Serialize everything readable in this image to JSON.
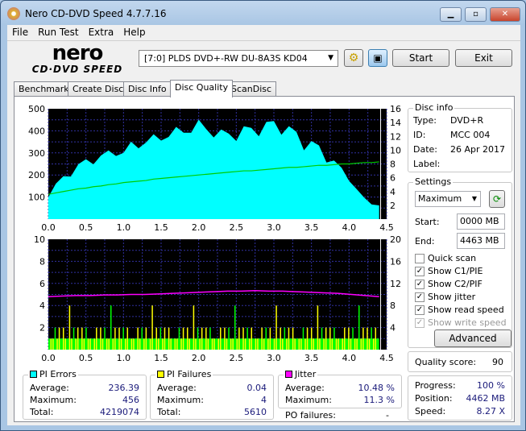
{
  "window": {
    "title": "Nero CD-DVD Speed 4.7.7.16"
  },
  "menu": [
    "File",
    "Run Test",
    "Extra",
    "Help"
  ],
  "toolbar": {
    "logo_top": "nero",
    "logo_bottom": "CD·DVD SPEED",
    "drive": "[7:0]  PLDS DVD+-RW DU-8A3S KD04",
    "start": "Start",
    "exit": "Exit"
  },
  "tabs": [
    "Benchmark",
    "Create Disc",
    "Disc Info",
    "Disc Quality",
    "ScanDisc"
  ],
  "active_tab": "Disc Quality",
  "disc_info": {
    "title": "Disc info",
    "type_label": "Type:",
    "type": "DVD+R",
    "id_label": "ID:",
    "id": "MCC 004",
    "date_label": "Date:",
    "date": "26 Apr 2017",
    "label_label": "Label:",
    "label": ""
  },
  "settings": {
    "title": "Settings",
    "speed": "Maximum",
    "start_label": "Start:",
    "start": "0000 MB",
    "end_label": "End:",
    "end": "4463 MB",
    "checks": [
      {
        "label": "Quick scan",
        "checked": false,
        "enabled": true
      },
      {
        "label": "Show C1/PIE",
        "checked": true,
        "enabled": true
      },
      {
        "label": "Show C2/PIF",
        "checked": true,
        "enabled": true
      },
      {
        "label": "Show jitter",
        "checked": true,
        "enabled": true
      },
      {
        "label": "Show read speed",
        "checked": true,
        "enabled": true
      },
      {
        "label": "Show write speed",
        "checked": true,
        "enabled": false
      }
    ],
    "advanced": "Advanced"
  },
  "quality": {
    "label": "Quality score:",
    "value": "90"
  },
  "progress": {
    "progress_label": "Progress:",
    "progress": "100 %",
    "position_label": "Position:",
    "position": "4462 MB",
    "speed_label": "Speed:",
    "speed": "8.27 X"
  },
  "pi_errors": {
    "title": "PI Errors",
    "color": "#00ffff",
    "average_label": "Average:",
    "average": "236.39",
    "maximum_label": "Maximum:",
    "maximum": "456",
    "total_label": "Total:",
    "total": "4219074"
  },
  "pi_failures": {
    "title": "PI Failures",
    "color": "#ffff00",
    "average_label": "Average:",
    "average": "0.04",
    "maximum_label": "Maximum:",
    "maximum": "4",
    "total_label": "Total:",
    "total": "5610"
  },
  "jitter": {
    "title": "Jitter",
    "color": "#ff00ff",
    "average_label": "Average:",
    "average": "10.48 %",
    "maximum_label": "Maximum:",
    "maximum": "11.3 %"
  },
  "po_failures": {
    "label": "PO failures:",
    "value": "-"
  },
  "chart_data": [
    {
      "type": "area",
      "xlim": [
        0,
        4.5
      ],
      "ylim": [
        0,
        500
      ],
      "y2lim": [
        0,
        16
      ],
      "xticks": [
        "0.0",
        "0.5",
        "1.0",
        "1.5",
        "2.0",
        "2.5",
        "3.0",
        "3.5",
        "4.0",
        "4.5"
      ],
      "yticks": [
        "100",
        "200",
        "300",
        "400",
        "500"
      ],
      "y2ticks": [
        "2",
        "4",
        "6",
        "8",
        "10",
        "12",
        "14",
        "16"
      ],
      "x": [
        0,
        0.1,
        0.2,
        0.3,
        0.4,
        0.5,
        0.6,
        0.7,
        0.8,
        0.9,
        1.0,
        1.1,
        1.2,
        1.3,
        1.4,
        1.5,
        1.6,
        1.7,
        1.8,
        1.9,
        2.0,
        2.1,
        2.2,
        2.3,
        2.4,
        2.5,
        2.6,
        2.7,
        2.8,
        2.9,
        3.0,
        3.1,
        3.2,
        3.3,
        3.4,
        3.5,
        3.6,
        3.7,
        3.8,
        3.9,
        4.0,
        4.1,
        4.2,
        4.3,
        4.4
      ],
      "series": [
        {
          "name": "PI Errors",
          "color": "#00ffff",
          "values": [
            110,
            150,
            180,
            210,
            235,
            250,
            265,
            275,
            285,
            300,
            290,
            320,
            330,
            340,
            350,
            360,
            370,
            380,
            390,
            395,
            410,
            400,
            380,
            370,
            375,
            370,
            385,
            395,
            400,
            405,
            420,
            415,
            390,
            370,
            345,
            330,
            310,
            280,
            250,
            215,
            185,
            130,
            90,
            70,
            60
          ]
        },
        {
          "name": "Read speed",
          "color": "#00cc00",
          "axis": "y2",
          "values": [
            3.6,
            3.8,
            4.0,
            4.2,
            4.4,
            4.5,
            4.7,
            4.8,
            5.0,
            5.1,
            5.3,
            5.4,
            5.5,
            5.6,
            5.8,
            5.9,
            6.0,
            6.1,
            6.2,
            6.3,
            6.4,
            6.5,
            6.6,
            6.7,
            6.8,
            6.9,
            7.0,
            7.0,
            7.1,
            7.2,
            7.3,
            7.4,
            7.5,
            7.5,
            7.6,
            7.7,
            7.8,
            7.8,
            7.9,
            8.0,
            8.0,
            8.1,
            8.2,
            8.2,
            8.3
          ]
        }
      ]
    },
    {
      "type": "bar",
      "xlim": [
        0,
        4.5
      ],
      "ylim": [
        0,
        10
      ],
      "y2lim": [
        0,
        20
      ],
      "xticks": [
        "0.0",
        "0.5",
        "1.0",
        "1.5",
        "2.0",
        "2.5",
        "3.0",
        "3.5",
        "4.0",
        "4.5"
      ],
      "yticks": [
        "2",
        "4",
        "6",
        "8",
        "10"
      ],
      "y2ticks": [
        "4",
        "8",
        "12",
        "16",
        "20"
      ],
      "series": [
        {
          "name": "PI Failures",
          "color": "#ffff00",
          "values_pattern": [
            1,
            2,
            1,
            1,
            2,
            1,
            2,
            1,
            1,
            2,
            4,
            1,
            2,
            1,
            1,
            2,
            1,
            1,
            2,
            1
          ]
        },
        {
          "name": "Jitter",
          "color": "#ff00ff",
          "axis": "y2",
          "values": [
            10.2,
            10.3,
            10.4,
            10.4,
            10.5,
            10.5,
            10.6,
            10.6,
            10.7,
            10.8,
            10.9,
            11.0,
            11.1,
            11.2,
            11.2,
            11.3,
            11.2,
            11.2,
            11.1,
            11.0,
            10.9,
            10.8,
            10.6,
            10.4,
            10.2
          ]
        }
      ]
    }
  ]
}
